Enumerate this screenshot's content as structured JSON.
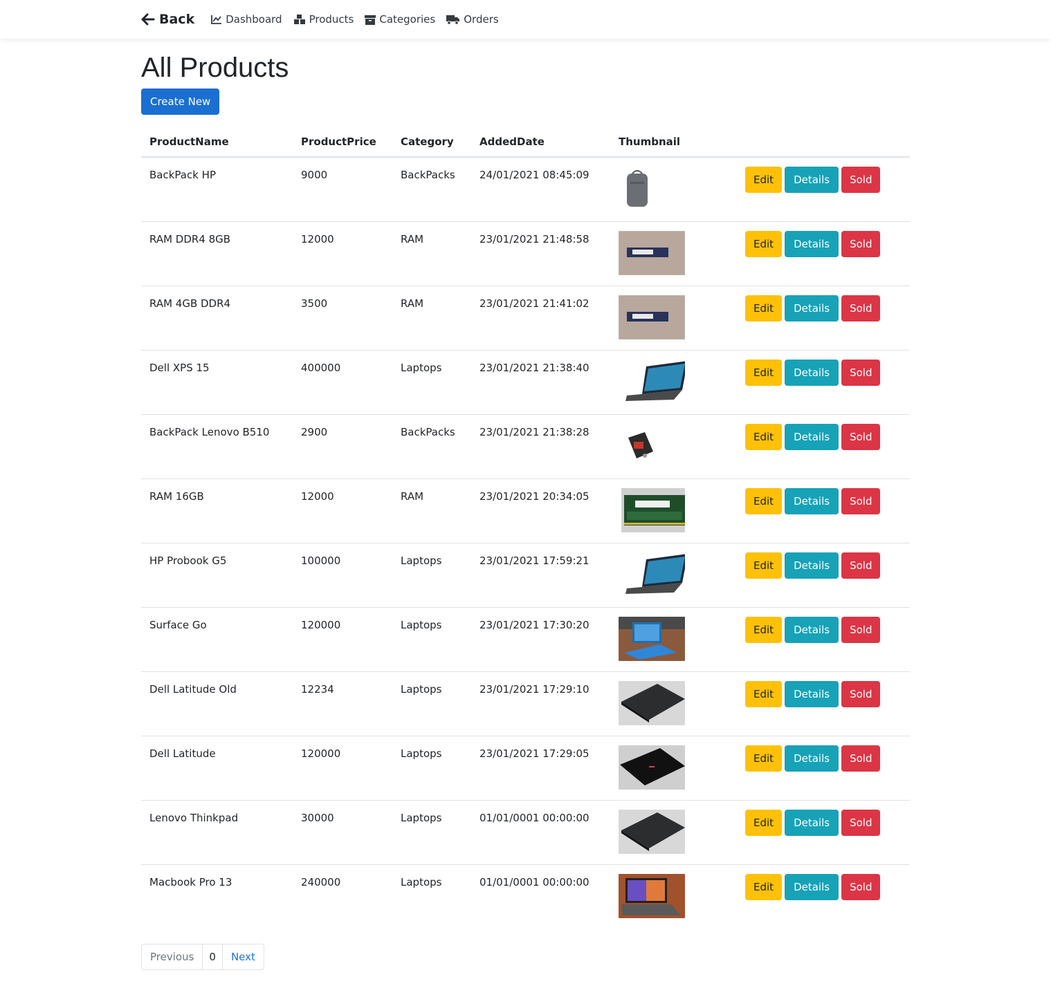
{
  "nav": {
    "back_label": "Back",
    "links": [
      {
        "label": "Dashboard",
        "icon": "chart-line-icon"
      },
      {
        "label": "Products",
        "icon": "boxes-icon"
      },
      {
        "label": "Categories",
        "icon": "archive-icon"
      },
      {
        "label": "Orders",
        "icon": "shipping-truck-icon"
      }
    ]
  },
  "page": {
    "title": "All Products",
    "create_label": "Create New"
  },
  "table": {
    "headers": [
      "ProductName",
      "ProductPrice",
      "Category",
      "AddedDate",
      "Thumbnail"
    ],
    "actions": {
      "edit": "Edit",
      "details": "Details",
      "sold": "Sold"
    },
    "rows": [
      {
        "name": "BackPack HP",
        "price": "9000",
        "category": "BackPacks",
        "date": "24/01/2021 08:45:09",
        "thumb": "backpack"
      },
      {
        "name": "RAM DDR4 8GB",
        "price": "12000",
        "category": "RAM",
        "date": "23/01/2021 21:48:58",
        "thumb": "ram-photo"
      },
      {
        "name": "RAM 4GB DDR4",
        "price": "3500",
        "category": "RAM",
        "date": "23/01/2021 21:41:02",
        "thumb": "ram-photo"
      },
      {
        "name": "Dell XPS 15",
        "price": "400000",
        "category": "Laptops",
        "date": "23/01/2021 21:38:40",
        "thumb": "laptop-white"
      },
      {
        "name": "BackPack Lenovo B510",
        "price": "2900",
        "category": "BackPacks",
        "date": "23/01/2021 21:38:28",
        "thumb": "backpack-black"
      },
      {
        "name": "RAM 16GB",
        "price": "12000",
        "category": "RAM",
        "date": "23/01/2021 20:34:05",
        "thumb": "ram-green"
      },
      {
        "name": "HP Probook G5",
        "price": "100000",
        "category": "Laptops",
        "date": "23/01/2021 17:59:21",
        "thumb": "laptop-white"
      },
      {
        "name": "Surface Go",
        "price": "120000",
        "category": "Laptops",
        "date": "23/01/2021 17:30:20",
        "thumb": "surface"
      },
      {
        "name": "Dell Latitude Old",
        "price": "12234",
        "category": "Laptops",
        "date": "23/01/2021 17:29:10",
        "thumb": "laptop-closed"
      },
      {
        "name": "Dell Latitude",
        "price": "120000",
        "category": "Laptops",
        "date": "23/01/2021 17:29:05",
        "thumb": "laptop-closed-dark"
      },
      {
        "name": "Lenovo Thinkpad",
        "price": "30000",
        "category": "Laptops",
        "date": "01/01/0001 00:00:00",
        "thumb": "laptop-closed"
      },
      {
        "name": "Macbook Pro 13",
        "price": "240000",
        "category": "Laptops",
        "date": "01/01/0001 00:00:00",
        "thumb": "macbook"
      }
    ]
  },
  "pagination": {
    "previous": "Previous",
    "page": "0",
    "next": "Next"
  },
  "colors": {
    "primary": "#1a6fd1",
    "warning": "#ffc107",
    "info": "#17a2b8",
    "danger": "#dc3545"
  }
}
